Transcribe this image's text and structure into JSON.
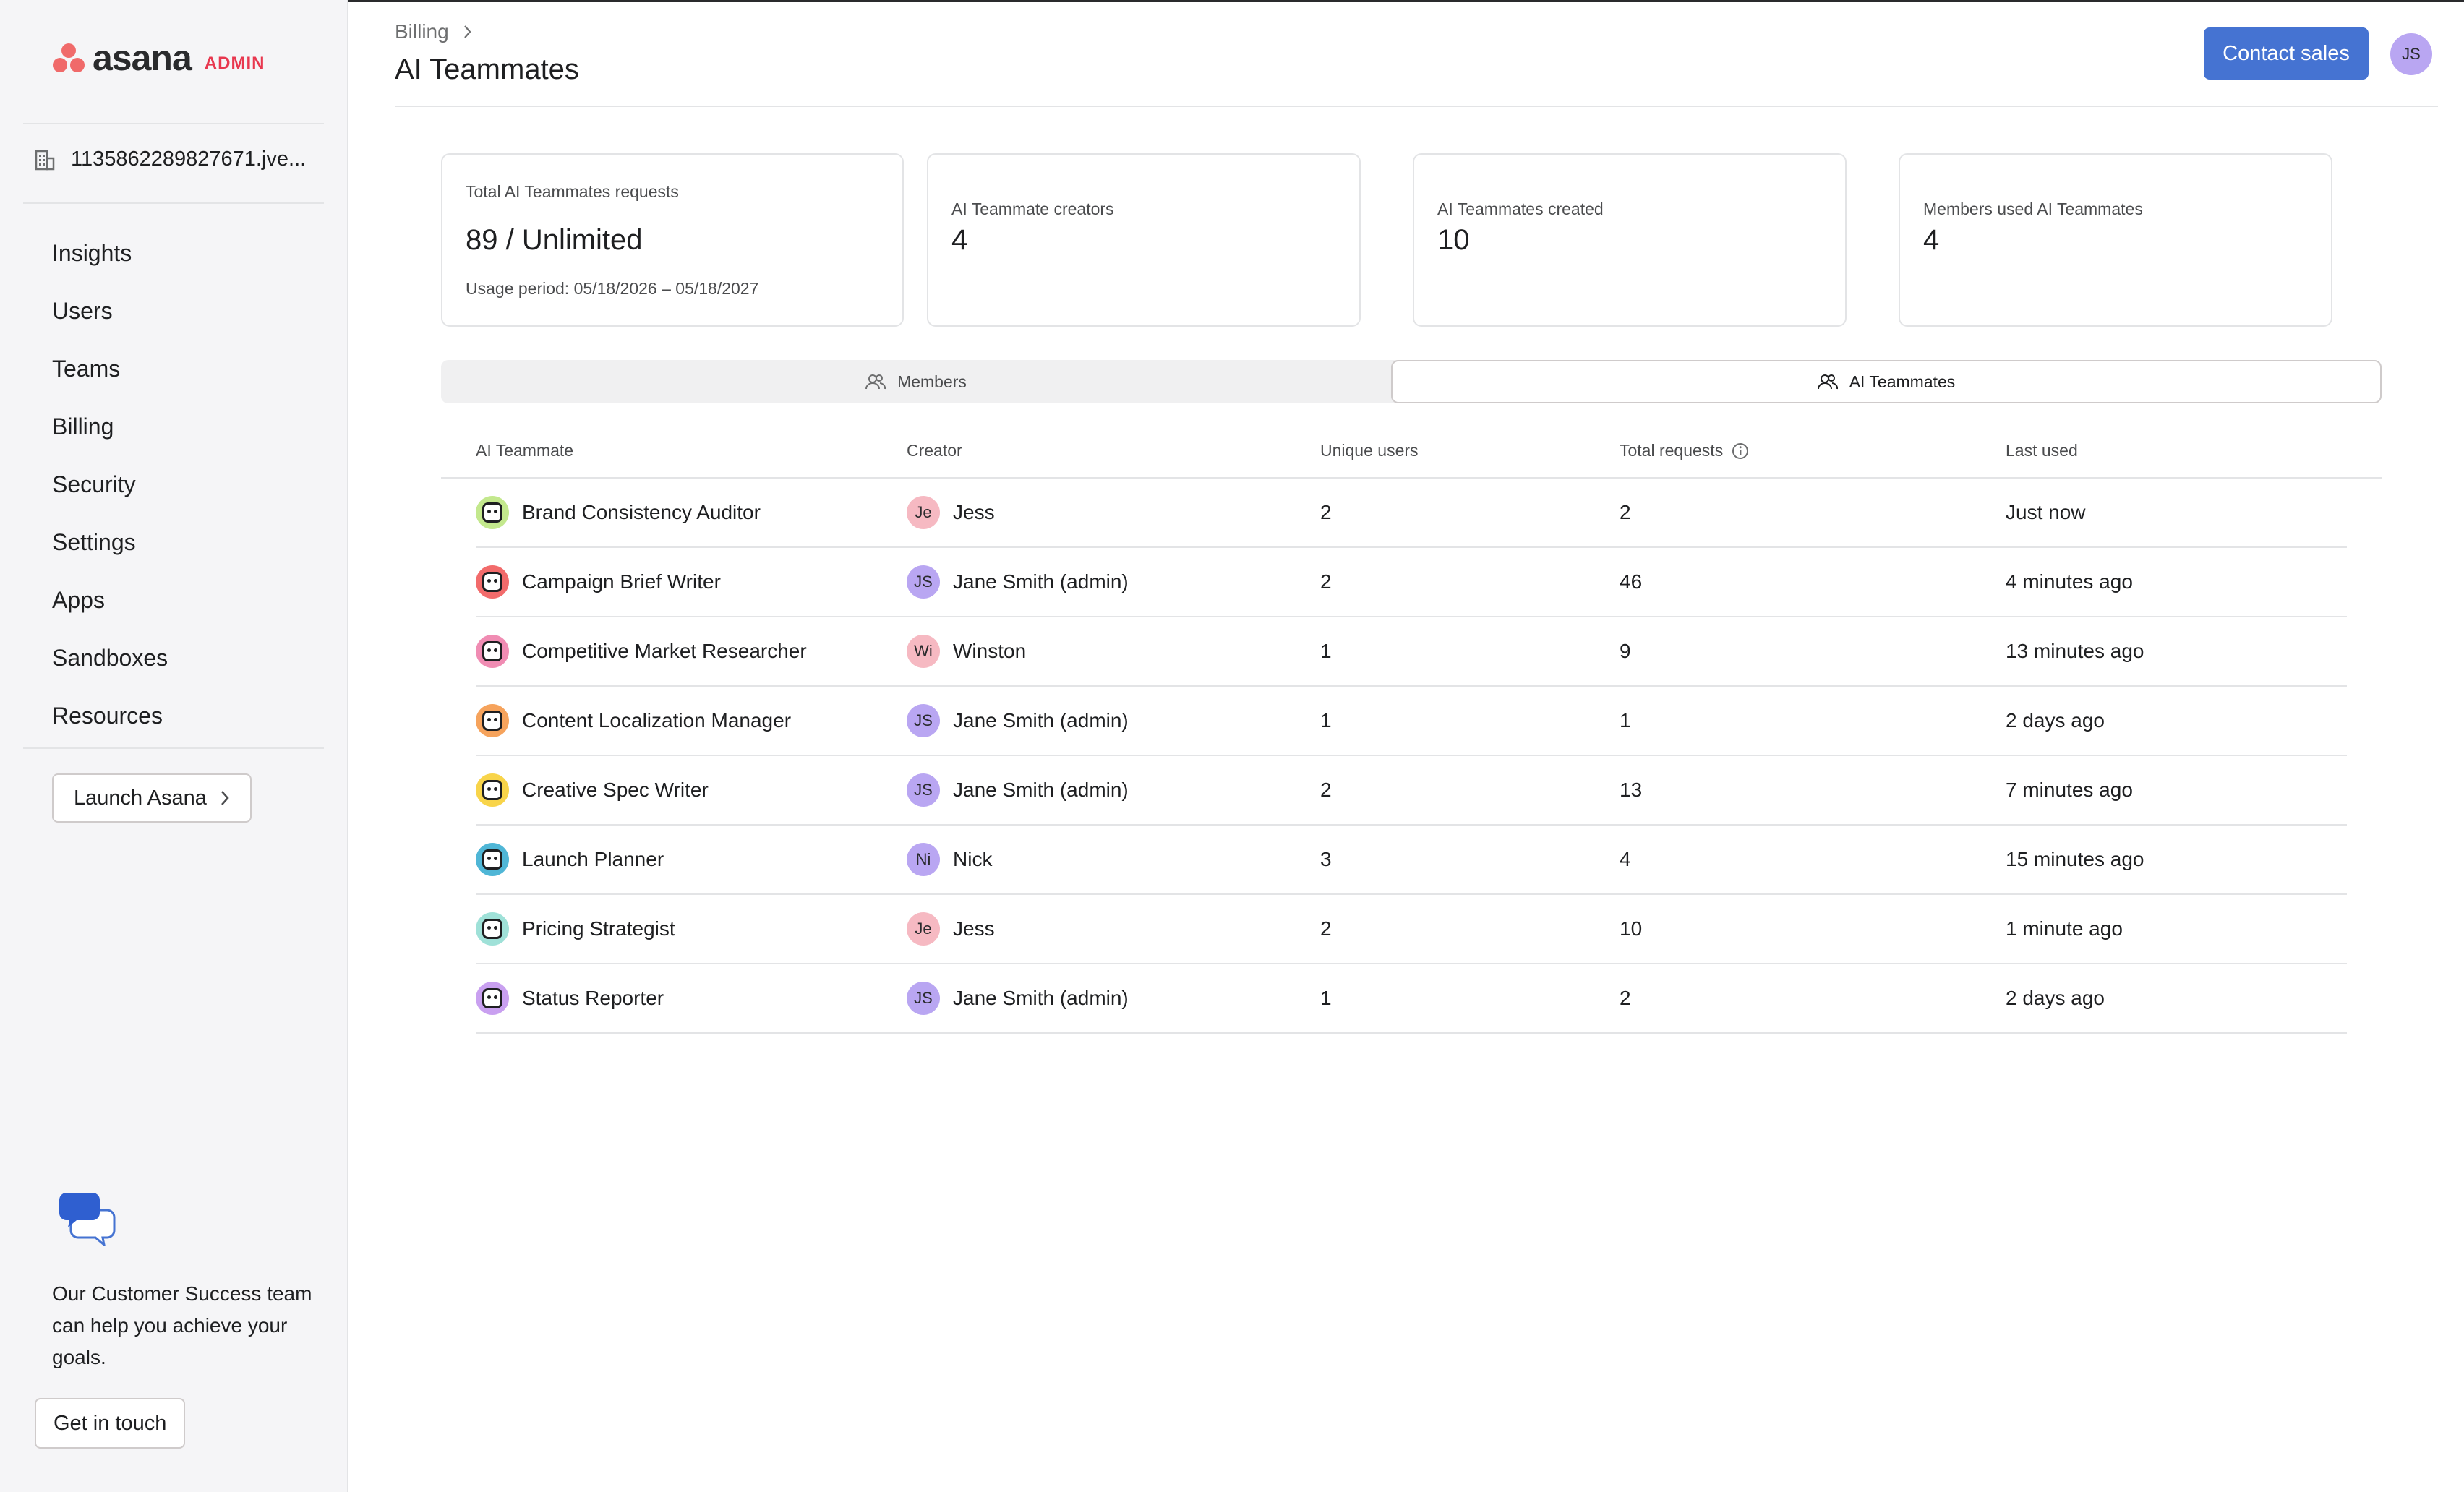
{
  "sidebar": {
    "logo_word": "asana",
    "logo_badge": "ADMIN",
    "org_name": "1135862289827671.jve...",
    "nav": [
      {
        "label": "Insights"
      },
      {
        "label": "Users"
      },
      {
        "label": "Teams"
      },
      {
        "label": "Billing"
      },
      {
        "label": "Security"
      },
      {
        "label": "Settings"
      },
      {
        "label": "Apps"
      },
      {
        "label": "Sandboxes"
      },
      {
        "label": "Resources"
      }
    ],
    "launch_label": "Launch Asana",
    "cs_text": "Our Customer Success team can help you achieve your goals.",
    "cs_button": "Get in touch"
  },
  "header": {
    "breadcrumb": "Billing",
    "title": "AI Teammates",
    "contact_label": "Contact sales",
    "avatar_initials": "JS"
  },
  "stats": {
    "total": {
      "label": "Total AI Teammates requests",
      "value": "89 / Unlimited",
      "sub": "Usage period: 05/18/2026 – 05/18/2027"
    },
    "creators": {
      "label": "AI Teammate creators",
      "value": "4"
    },
    "created": {
      "label": "AI Teammates created",
      "value": "10"
    },
    "members": {
      "label": "Members used AI Teammates",
      "value": "4"
    }
  },
  "tabs": {
    "members": "Members",
    "ai": "AI Teammates"
  },
  "table": {
    "headers": {
      "teammate": "AI Teammate",
      "creator": "Creator",
      "unique": "Unique users",
      "total": "Total requests",
      "last": "Last used"
    },
    "rows": [
      {
        "name": "Brand Consistency Auditor",
        "creator": "Jess",
        "initials": "Je",
        "unique": "2",
        "total": "2",
        "last": "Just now"
      },
      {
        "name": "Campaign Brief Writer",
        "creator": "Jane Smith (admin)",
        "initials": "JS",
        "unique": "2",
        "total": "46",
        "last": "4 minutes ago"
      },
      {
        "name": "Competitive Market Researcher",
        "creator": "Winston",
        "initials": "Wi",
        "unique": "1",
        "total": "9",
        "last": "13 minutes ago"
      },
      {
        "name": "Content Localization Manager",
        "creator": "Jane Smith (admin)",
        "initials": "JS",
        "unique": "1",
        "total": "1",
        "last": "2 days ago"
      },
      {
        "name": "Creative Spec Writer",
        "creator": "Jane Smith (admin)",
        "initials": "JS",
        "unique": "2",
        "total": "13",
        "last": "7 minutes ago"
      },
      {
        "name": "Launch Planner",
        "creator": "Nick",
        "initials": "Ni",
        "unique": "3",
        "total": "4",
        "last": "15 minutes ago"
      },
      {
        "name": "Pricing Strategist",
        "creator": "Jess",
        "initials": "Je",
        "unique": "2",
        "total": "10",
        "last": "1 minute ago"
      },
      {
        "name": "Status Reporter",
        "creator": "Jane Smith (admin)",
        "initials": "JS",
        "unique": "1",
        "total": "2",
        "last": "2 days ago"
      }
    ]
  },
  "colors": {
    "primary": "#4573d2",
    "logo": "#f06a6a",
    "admin_badge": "#e8384f",
    "teammate_icons": [
      "#c3e88d",
      "#f26b6b",
      "#f08cb3",
      "#f6a35c",
      "#f8d44a",
      "#4fb6d6",
      "#9fe1d8",
      "#c9a0f0"
    ],
    "avatar_colors": {
      "Je": "#f6b9c2",
      "JS": "#b9a6f2",
      "Wi": "#f6b9c2",
      "Ni": "#b9a6f2"
    }
  }
}
